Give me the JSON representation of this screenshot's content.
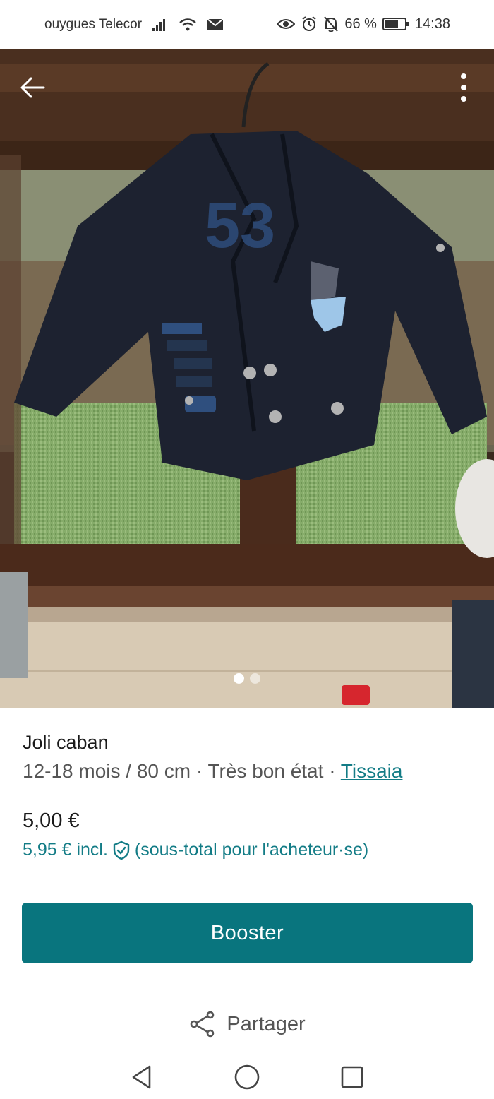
{
  "status_bar": {
    "carrier": "ouygues Telecor",
    "battery": "66 %",
    "time": "14:38"
  },
  "listing": {
    "title": "Joli caban",
    "details": "12-18 mois / 80 cm · Très bon état · ",
    "brand": "Tissaia",
    "price": "5,00 €",
    "price_incl": "5,95 € incl.",
    "price_incl_note": "(sous-total pour l'acheteur·se)"
  },
  "photo": {
    "current_index": 1,
    "count": 2
  },
  "actions": {
    "boost_label": "Booster",
    "share_label": "Partager"
  },
  "colors": {
    "accent": "#09757e",
    "link": "#137c86"
  },
  "icons": {
    "back": "arrow-left-icon",
    "more": "more-vertical-icon",
    "share": "share-icon",
    "protection": "shield-check-icon",
    "nav_back": "triangle-back-icon",
    "nav_home": "circle-home-icon",
    "nav_recents": "square-recents-icon"
  }
}
